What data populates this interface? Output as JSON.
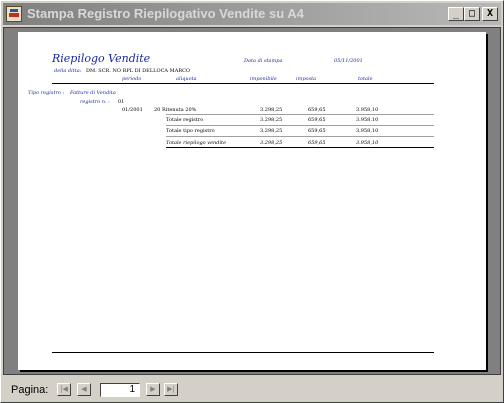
{
  "window": {
    "title": "Stampa Registro Riepilogativo Vendite su A4"
  },
  "title_buttons": {
    "minimize": "_",
    "maximize": "□",
    "close": "X"
  },
  "report": {
    "title": "Riepilogo Vendite",
    "date_label": "Data di stampa",
    "date_value": "05/11/2001",
    "company_label": "della ditta:",
    "company_name": "DM. SCR. NO RPL DI DELLOCA MARCO",
    "columns": [
      "periodo",
      "aliquota",
      "imponibile",
      "imposta",
      "totale"
    ],
    "register_type_label": "Tipo registro :",
    "register_type_value": "Fatture di Vendita",
    "register_no_label": "registro n. :",
    "register_no_value": "01",
    "rows": [
      {
        "period": "01/2001",
        "aliquota": "20 Ritenuta 20%",
        "imponibile": "3.298,25",
        "imposta": "659,65",
        "totale": "3.958,10"
      }
    ],
    "total_register": {
      "label": "Totale registro",
      "imponibile": "3.298,25",
      "imposta": "659,65",
      "totale": "3.958,10"
    },
    "total_type": {
      "label": "Totale tipo registro",
      "imponibile": "3.298,25",
      "imposta": "659,65",
      "totale": "3.958,10"
    },
    "total_summary": {
      "label": "Totale riepilogo vendite",
      "imponibile": "3.298,25",
      "imposta": "659,65",
      "totale": "3.958,10"
    }
  },
  "statusbar": {
    "page_label": "Pagina:",
    "page_value": "1",
    "nav": {
      "first": "|◀",
      "prev": "◀",
      "next": "▶",
      "last": "▶|"
    }
  }
}
